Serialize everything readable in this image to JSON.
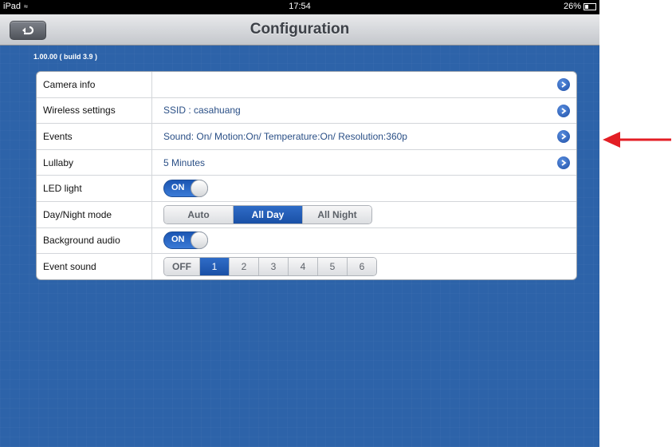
{
  "statusbar": {
    "device": "iPad",
    "time": "17:54",
    "battery": "26%"
  },
  "navbar": {
    "title": "Configuration"
  },
  "version": "1.00.00 ( build 3.9 )",
  "rows": [
    {
      "label": "Camera info",
      "value": ""
    },
    {
      "label": "Wireless settings",
      "value": "SSID : casahuang"
    },
    {
      "label": "Events",
      "value": "Sound: On/ Motion:On/ Temperature:On/ Resolution:360p"
    },
    {
      "label": "Lullaby",
      "value": "5 Minutes"
    },
    {
      "label": "LED light",
      "toggle": "ON"
    },
    {
      "label": "Day/Night mode",
      "options": [
        "Auto",
        "All Day",
        "All Night"
      ],
      "selected": "All Day"
    },
    {
      "label": "Background audio",
      "toggle": "ON"
    },
    {
      "label": "Event sound",
      "options": [
        "OFF",
        "1",
        "2",
        "3",
        "4",
        "5",
        "6"
      ],
      "selected": "1"
    }
  ],
  "colors": {
    "background": "#2d63a9",
    "accent": "#1f57b5",
    "annotation_arrow": "#e31e24"
  },
  "icons": {
    "back": "back-arrow-icon",
    "disclosure": "chevron-right-circle-icon",
    "annotation": "red-arrow-icon"
  }
}
